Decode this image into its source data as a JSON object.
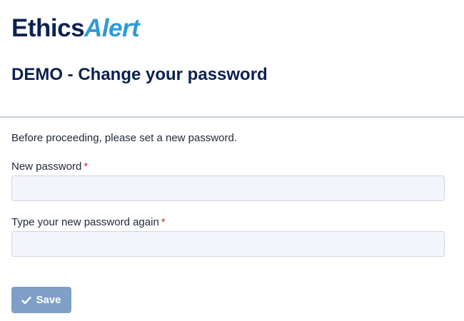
{
  "brand": {
    "part1": "Ethics",
    "part2": "Alert"
  },
  "page": {
    "title": "DEMO - Change your password",
    "intro": "Before proceeding, please set a new password."
  },
  "form": {
    "new_password": {
      "label": "New password",
      "required_marker": "*",
      "value": ""
    },
    "confirm_password": {
      "label": "Type your new password again",
      "required_marker": "*",
      "value": ""
    },
    "save_label": "Save",
    "save_icon": "check-icon"
  },
  "colors": {
    "brand_dark": "#0b2150",
    "brand_accent": "#2f9ad6",
    "required": "#d0312d",
    "button_bg": "#7f9fc6",
    "input_bg": "#f4f5fa"
  }
}
